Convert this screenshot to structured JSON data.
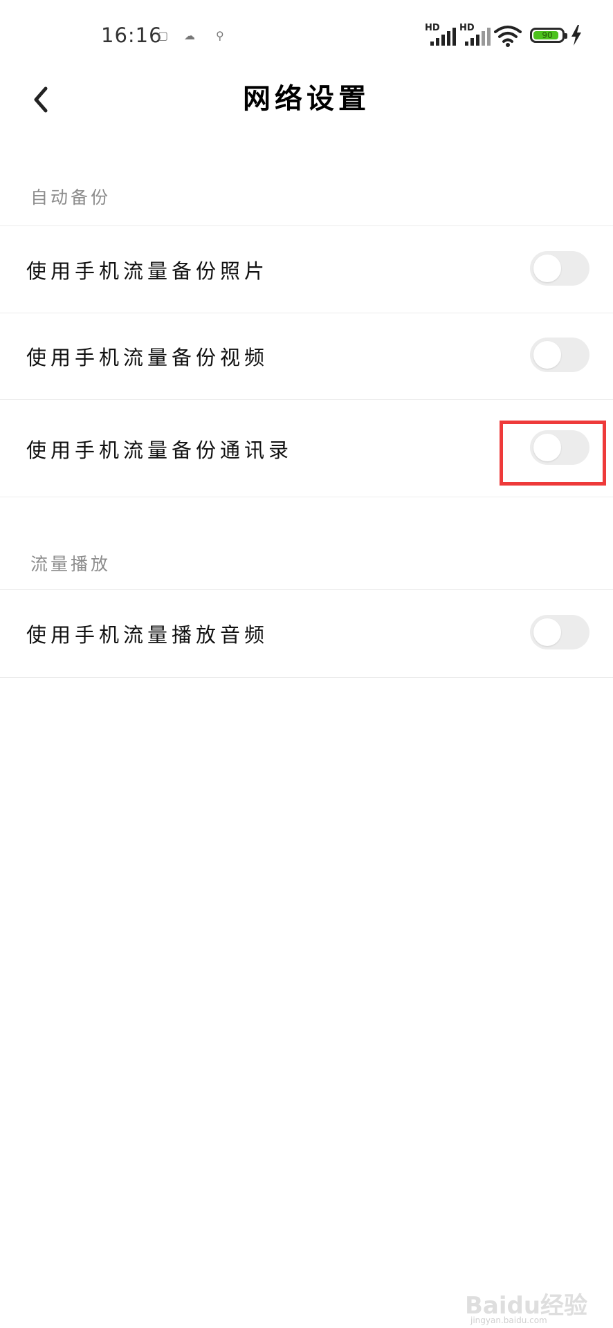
{
  "status_bar": {
    "time": "16:16",
    "notification_icons": [
      "calendar-icon",
      "weather-icon",
      "location-icon"
    ],
    "signal_label_1": "HD",
    "signal_label_2": "HD",
    "battery_level": "90",
    "battery_color": "#4cc21c"
  },
  "header": {
    "title": "网络设置"
  },
  "sections": [
    {
      "title": "自动备份",
      "items": [
        {
          "label": "使用手机流量备份照片",
          "enabled": false
        },
        {
          "label": "使用手机流量备份视频",
          "enabled": false
        },
        {
          "label": "使用手机流量备份通讯录",
          "enabled": false
        }
      ]
    },
    {
      "title": "流量播放",
      "items": [
        {
          "label": "使用手机流量播放音频",
          "enabled": false
        }
      ]
    }
  ],
  "annotation": {
    "highlight_color": "#ee3a3a"
  },
  "watermark": {
    "text": "Baidu经验",
    "sub": "jingyan.baidu.com"
  }
}
